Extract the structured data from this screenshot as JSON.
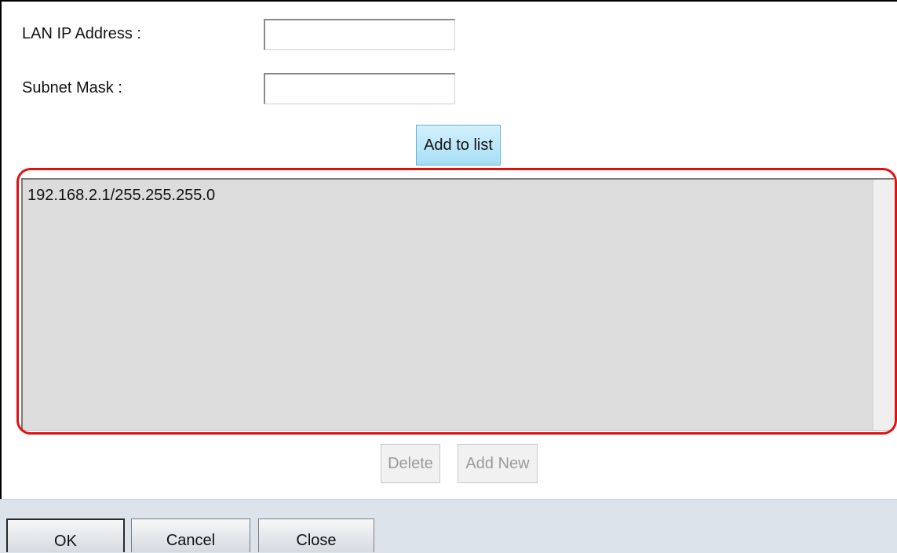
{
  "form": {
    "lan_ip_label": "LAN IP Address :",
    "lan_ip_value": "",
    "subnet_mask_label": "Subnet Mask :",
    "subnet_mask_value": "",
    "add_to_list_label": "Add to list"
  },
  "list": {
    "items": [
      "192.168.2.1/255.255.255.0"
    ]
  },
  "list_actions": {
    "delete_label": "Delete",
    "add_new_label": "Add New"
  },
  "footer": {
    "ok_label": "OK",
    "cancel_label": "Cancel",
    "close_label": "Close"
  },
  "colors": {
    "highlight": "#e01010",
    "add_button": "#a7def5",
    "footer_bg": "#dde3ea"
  }
}
